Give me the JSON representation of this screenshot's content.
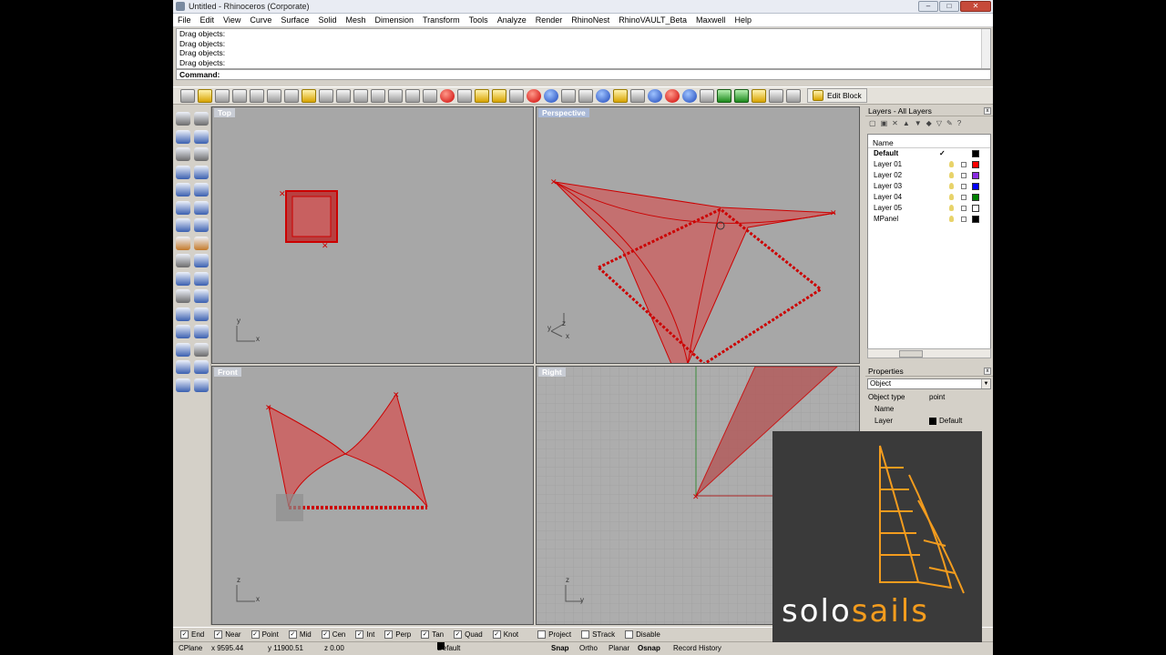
{
  "window": {
    "title": "Untitled - Rhinoceros (Corporate)",
    "min": "–",
    "max": "□",
    "close": "✕"
  },
  "menu": [
    "File",
    "Edit",
    "View",
    "Curve",
    "Surface",
    "Solid",
    "Mesh",
    "Dimension",
    "Transform",
    "Tools",
    "Analyze",
    "Render",
    "RhinoNest",
    "RhinoVAULT_Beta",
    "Maxwell",
    "Help"
  ],
  "history": [
    "Drag objects:",
    "Drag objects:",
    "Drag objects:",
    "Drag objects:"
  ],
  "command": {
    "label": "Command:",
    "value": ""
  },
  "toolbar": {
    "edit_block": "Edit Block"
  },
  "viewports": {
    "top": "Top",
    "perspective": "Perspective",
    "front": "Front",
    "right": "Right"
  },
  "axes": {
    "x": "x",
    "y": "y",
    "z": "z"
  },
  "layers": {
    "panel_title": "Layers - All Layers",
    "col_name": "Name",
    "current_mark": "✓",
    "rows": [
      {
        "name": "Default",
        "color": "#000000",
        "current": true
      },
      {
        "name": "Layer 01",
        "color": "#ff0000"
      },
      {
        "name": "Layer 02",
        "color": "#8a2be2"
      },
      {
        "name": "Layer 03",
        "color": "#0000ff"
      },
      {
        "name": "Layer 04",
        "color": "#008000"
      },
      {
        "name": "Layer 05",
        "color": "#ffffff"
      },
      {
        "name": "MPanel",
        "color": "#000000"
      }
    ]
  },
  "properties": {
    "panel_title": "Properties",
    "selector": "Object",
    "object_type_label": "Object type",
    "object_type_value": "point",
    "name_label": "Name",
    "layer_label": "Layer",
    "layer_value": "Default"
  },
  "osnap": [
    {
      "label": "End",
      "checked": true
    },
    {
      "label": "Near",
      "checked": true
    },
    {
      "label": "Point",
      "checked": true
    },
    {
      "label": "Mid",
      "checked": true
    },
    {
      "label": "Cen",
      "checked": true
    },
    {
      "label": "Int",
      "checked": true
    },
    {
      "label": "Perp",
      "checked": true
    },
    {
      "label": "Tan",
      "checked": true
    },
    {
      "label": "Quad",
      "checked": true
    },
    {
      "label": "Knot",
      "checked": true
    },
    {
      "label": "Project",
      "checked": false
    },
    {
      "label": "STrack",
      "checked": false
    },
    {
      "label": "Disable",
      "checked": false
    }
  ],
  "status": {
    "cplane": "CPlane",
    "x": "x 9595.44",
    "y": "y 11900.51",
    "z": "z 0.00",
    "layer": "Default",
    "snap": "Snap",
    "ortho": "Ortho",
    "planar": "Planar",
    "osnap": "Osnap",
    "record": "Record History"
  },
  "watermark": {
    "part1": "solo",
    "part2": "sails",
    "accent_color": "#f39c1e"
  }
}
